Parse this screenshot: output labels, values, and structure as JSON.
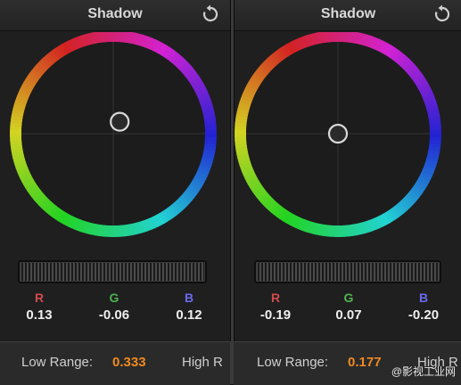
{
  "panels": [
    {
      "title": "Shadow",
      "rgb": {
        "r_label": "R",
        "g_label": "G",
        "b_label": "B",
        "r": "0.13",
        "g": "-0.06",
        "b": "0.12"
      },
      "puck_offset": {
        "dx": 0.07,
        "dy": -0.13
      },
      "low_range_label": "Low Range:",
      "low_range_value": "0.333",
      "high_range_label": "High R"
    },
    {
      "title": "Shadow",
      "rgb": {
        "r_label": "R",
        "g_label": "G",
        "b_label": "B",
        "r": "-0.19",
        "g": "0.07",
        "b": "-0.20"
      },
      "puck_offset": {
        "dx": 0.0,
        "dy": 0.0
      },
      "low_range_label": "Low Range:",
      "low_range_value": "0.177",
      "high_range_label": "High R"
    }
  ],
  "colors": {
    "r_label": "#d24a4a",
    "g_label": "#4fb24f",
    "b_label": "#6a6af0",
    "value_accent": "#f08a1f"
  },
  "icons": {
    "reset": "reset-icon"
  },
  "watermark": "@影视工业网"
}
